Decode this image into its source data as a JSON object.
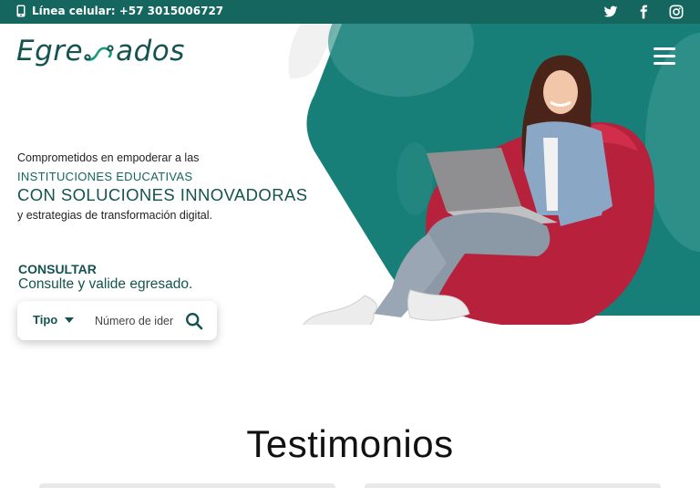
{
  "topbar": {
    "phone_label": "Línea celular: +57 3015006727",
    "icons": [
      "phone-icon",
      "twitter-icon",
      "facebook-icon",
      "instagram-icon"
    ]
  },
  "header": {
    "logo_left": "Egre",
    "logo_right": "ados",
    "menu_icon": "hamburger-icon"
  },
  "hero": {
    "tagline": "Comprometidos en empoderar a las",
    "institutions": "INSTITUCIONES EDUCATIVAS",
    "solutions": "CON SOLUCIONES INNOVADORAS",
    "strategies": "y estrategias de transformación digital."
  },
  "consult": {
    "title": "CONSULTAR",
    "subtitle": "Consulte y valide egresado.",
    "tipo_label": "Tipo",
    "input_placeholder": "Número de identificación",
    "search_icon": "search-icon"
  },
  "testimonials": {
    "title": "Testimonios"
  },
  "colors": {
    "brand_dark": "#14534f",
    "brand_teal": "#14665f",
    "hero_teal": "#177f78"
  }
}
